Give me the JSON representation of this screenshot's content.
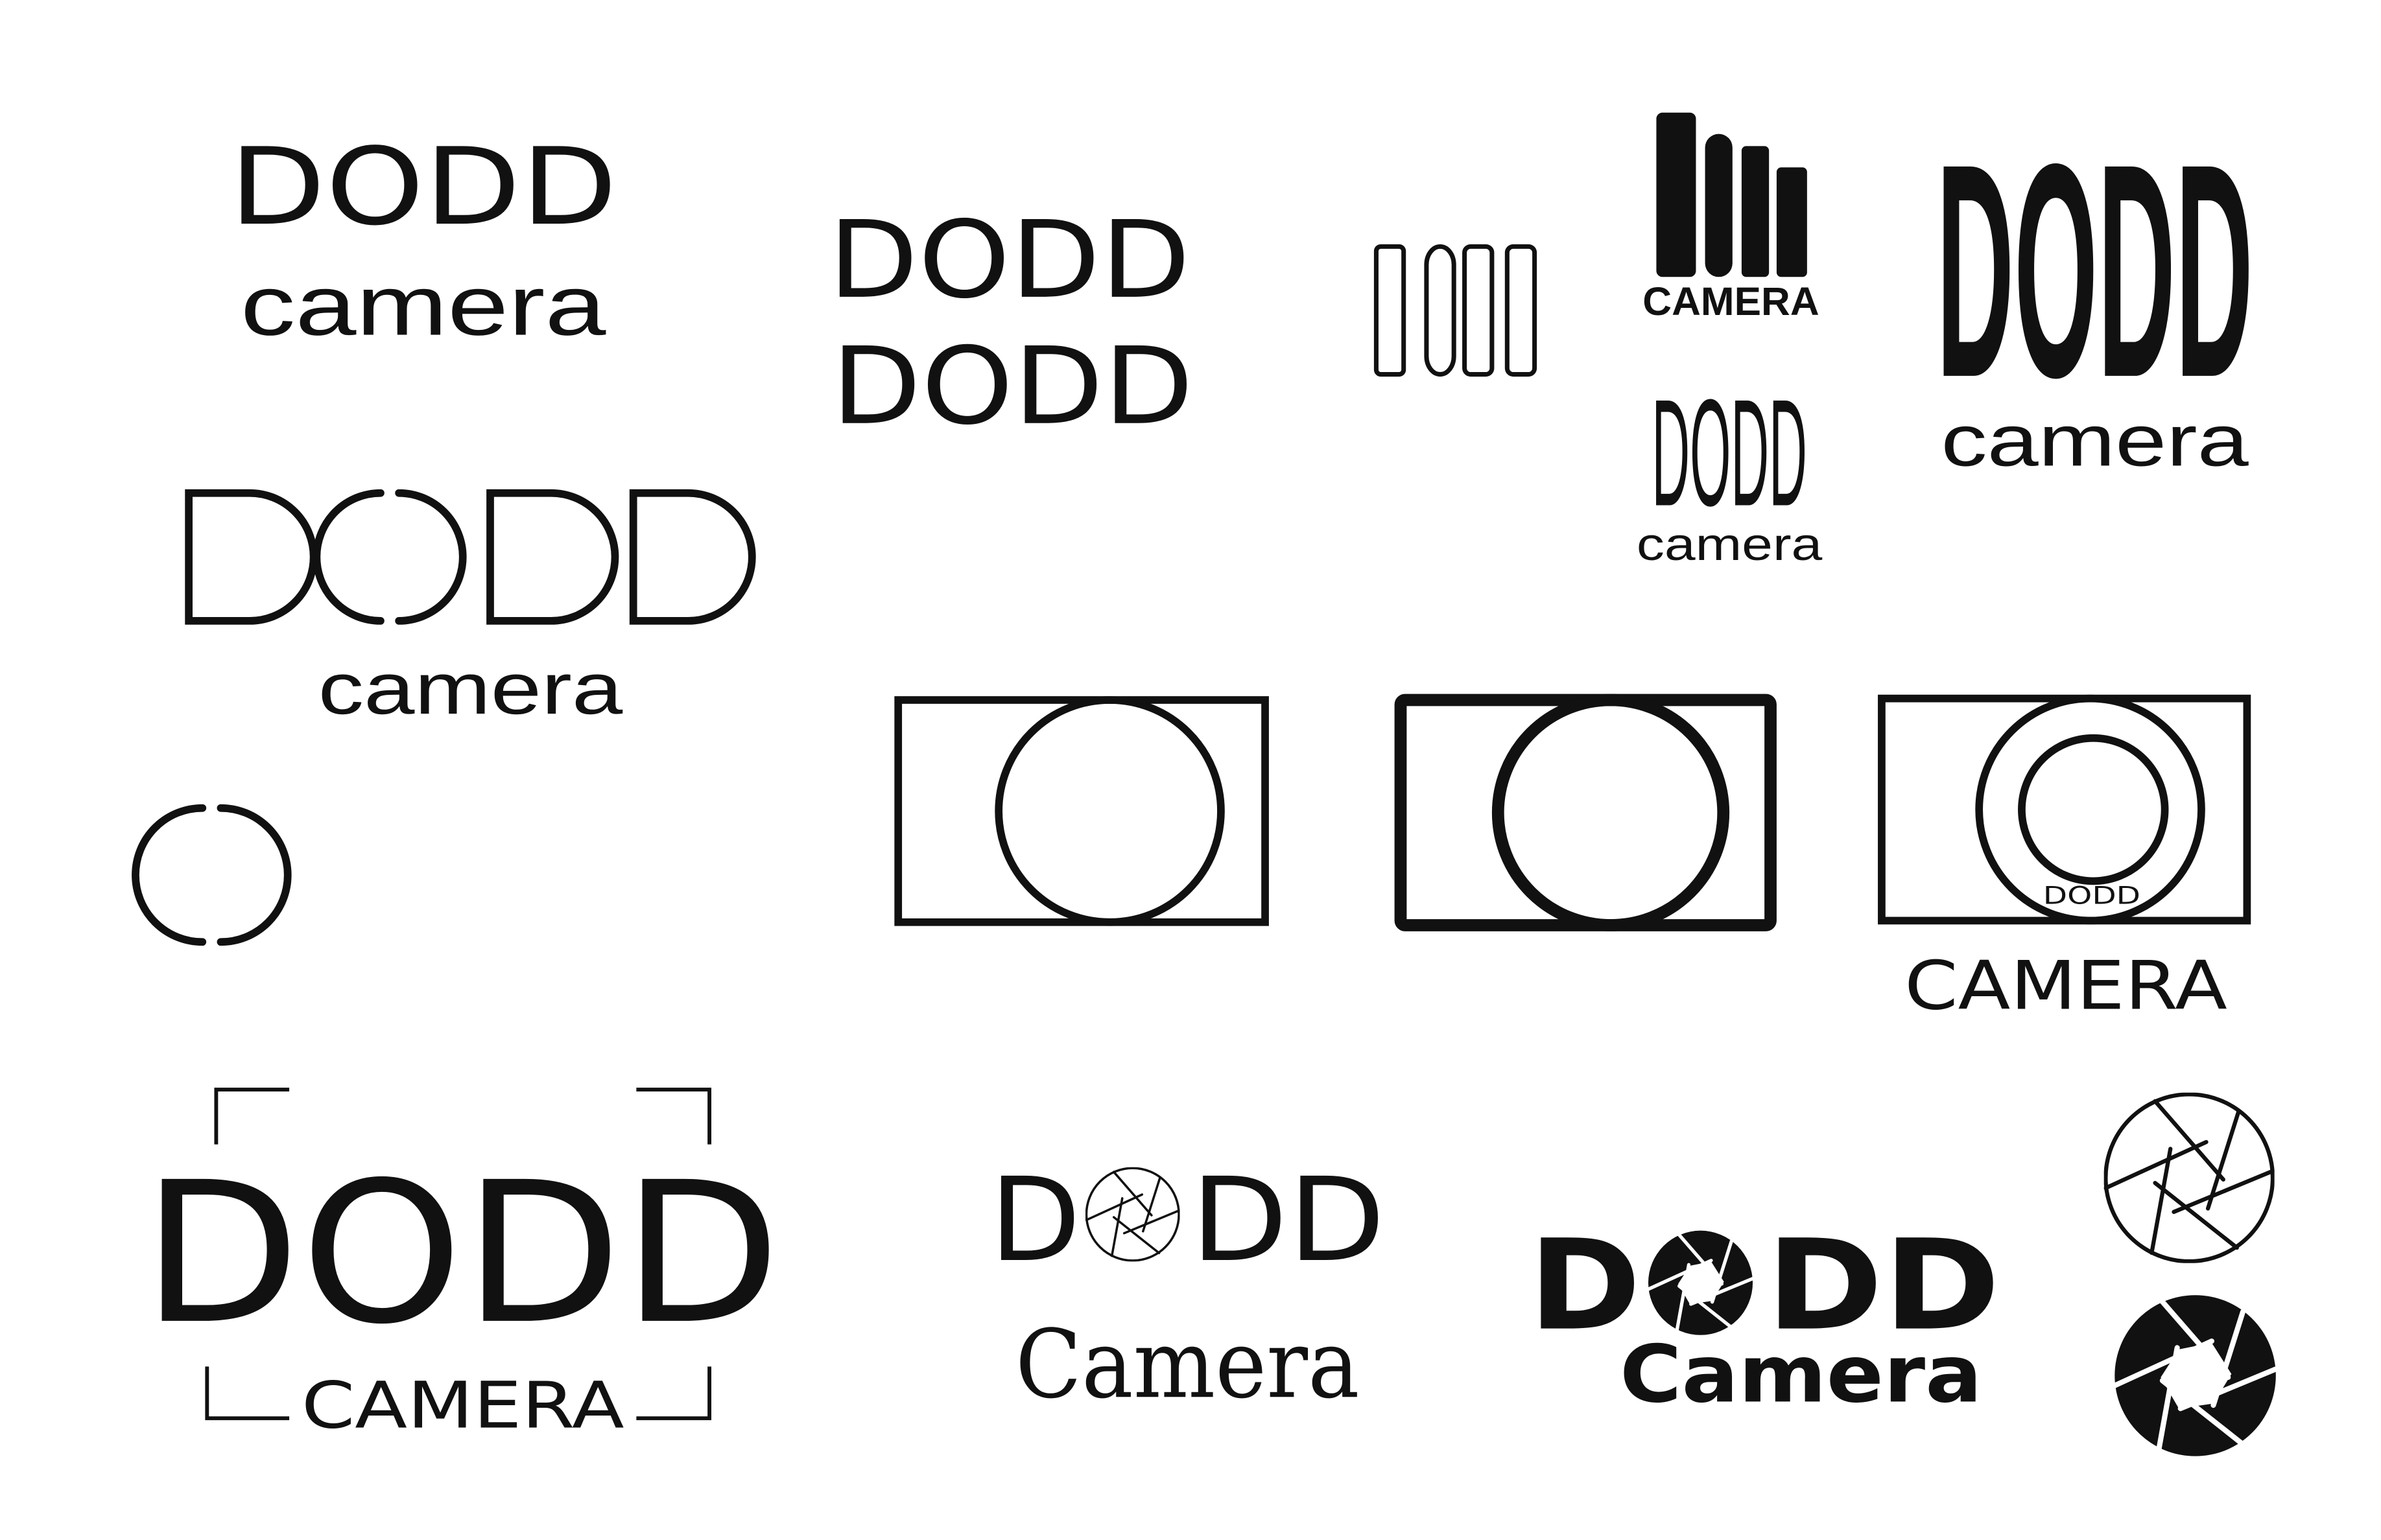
{
  "colors": {
    "background": "#ffffff",
    "ink": "#111111"
  },
  "logos": {
    "top_left": {
      "wordmark": "DODD",
      "tagline": "camera"
    },
    "stacked_pair": {
      "line1": "DODD",
      "line2": "DODD"
    },
    "tall_outline": {
      "wordmark": "DODD"
    },
    "bars": {
      "tagline": "CAMERA"
    },
    "tall_small": {
      "wordmark": "DODD",
      "tagline": "camera"
    },
    "bold_tall": {
      "wordmark": "DODD",
      "tagline": "camera"
    },
    "broken_o": {
      "wordmark": "DODD",
      "tagline": "camera"
    },
    "camera_box_lens": {
      "lens_text": "DODD",
      "tagline": "CAMERA"
    },
    "bracket_frame": {
      "wordmark": "DODD",
      "tagline": "CAMERA"
    },
    "aperture_outline": {
      "wordmark_left": "D",
      "wordmark_right": "DD",
      "tagline": "Camera"
    },
    "aperture_bold": {
      "wordmark_left": "D",
      "wordmark_right": "DD",
      "tagline": "Camera"
    }
  },
  "icons": [
    "broken-circle-icon",
    "camera-body-thin-icon",
    "camera-body-thick-icon",
    "camera-body-lens-icon",
    "aperture-outline-icon",
    "aperture-filled-icon"
  ]
}
